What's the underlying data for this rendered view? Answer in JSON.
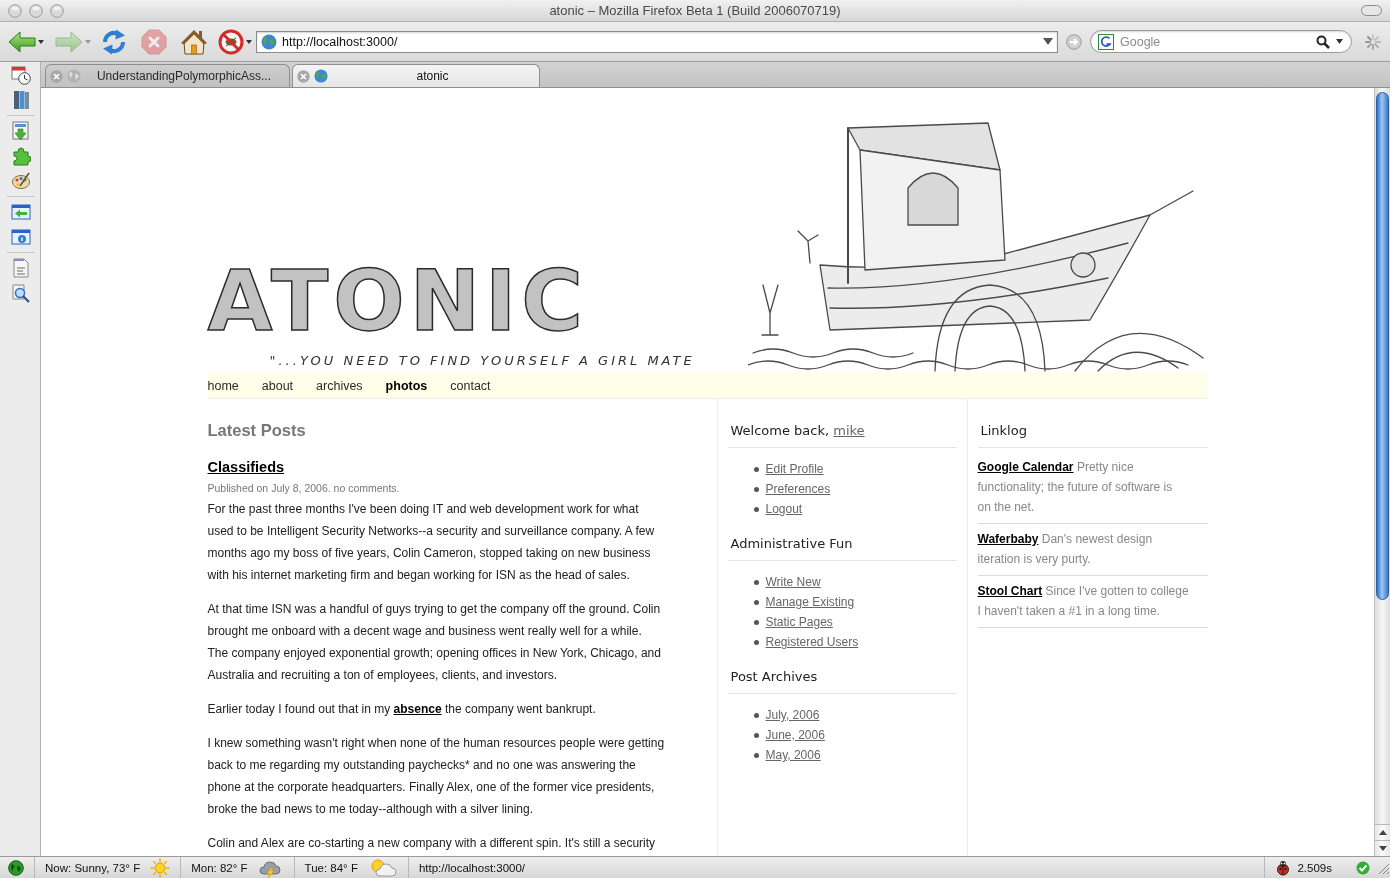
{
  "window": {
    "title": "atonic – Mozilla Firefox Beta 1 (Build 2006070719)"
  },
  "toolbar": {
    "back": {
      "disabled": false
    },
    "forward": {
      "disabled": true
    },
    "stop": {
      "disabled": true
    },
    "address": {
      "value": "http://localhost:3000/"
    },
    "search": {
      "placeholder": "Google"
    }
  },
  "tabs": [
    {
      "label": "UnderstandingPolymorphicAss...",
      "selected": false
    },
    {
      "label": "atonic",
      "selected": true
    }
  ],
  "header": {
    "logo": "ATONIC",
    "tagline": "\"...YOU NEED TO FIND YOURSELF A GIRL MATE"
  },
  "nav": [
    {
      "label": "home",
      "selected": false
    },
    {
      "label": "about",
      "selected": false
    },
    {
      "label": "archives",
      "selected": false
    },
    {
      "label": "photos",
      "selected": true
    },
    {
      "label": "contact",
      "selected": false
    }
  ],
  "main": {
    "heading": "Latest Posts",
    "post": {
      "title": "Classifieds",
      "meta": "Published on July 8, 2006. no comments.",
      "paragraphs": [
        {
          "segments": [
            {
              "kind": "text",
              "text": "For the past three months I've been doing IT and web development work for what\nused to be Intelligent Security Networks--a security and surveillance company. A few\nmonths ago my boss of five years, Colin Cameron, stopped taking on new business\nwith his internet marketing firm and began working for ISN as the head of sales."
            }
          ]
        },
        {
          "segments": [
            {
              "kind": "text",
              "text": "At that time ISN was a handful of guys trying to get the company off the ground. Colin\nbrought me onboard with a decent wage and business went really well for a while.\nThe company enjoyed exponential growth; opening offices in New York, Chicago, and\nAustralia and recruiting a ton of employees, clients, and investors."
            }
          ]
        },
        {
          "segments": [
            {
              "kind": "text",
              "text": "Earlier today I found out that in my "
            },
            {
              "kind": "link",
              "text": "absence"
            },
            {
              "kind": "text",
              "text": " the company went bankrupt."
            }
          ]
        },
        {
          "segments": [
            {
              "kind": "text",
              "text": "I knew something wasn't right when none of the human resources people were getting\nback to me regarding my outstanding paychecks* and no one was answering the\nphone at the corporate headquarters. Finally Alex, one of the former vice presidents,\nbroke the bad news to me today--although with a silver lining."
            }
          ]
        },
        {
          "segments": [
            {
              "kind": "text",
              "text": "Colin and Alex are co-starting a new company with a different spin. It's still a security"
            }
          ]
        }
      ]
    }
  },
  "sidebar": {
    "sections": [
      {
        "title": "Welcome back,",
        "title_link": "mike",
        "links": [
          "Edit Profile",
          "Preferences",
          "Logout"
        ]
      },
      {
        "title": "Administrative Fun",
        "links": [
          "Write New",
          "Manage Existing",
          "Static Pages",
          "Registered Users"
        ]
      },
      {
        "title": "Post Archives",
        "links": [
          "July, 2006",
          "June, 2006",
          "May, 2006"
        ]
      }
    ]
  },
  "linklog": {
    "title": "Linklog",
    "entries": [
      {
        "link": "Google Calendar",
        "text": "Pretty nice\nfunctionality; the future of software is\non the net."
      },
      {
        "link": "Waferbaby",
        "text": "Dan's newest design\niteration is very purty."
      },
      {
        "link": "Stool Chart",
        "text": "Since I've gotten to college\nI haven't taken a #1 in a long time."
      }
    ]
  },
  "status_bar": {
    "weather": [
      {
        "kind": "sunny",
        "label": "Now: Sunny, 73° F"
      },
      {
        "kind": "storm",
        "label": "Mon: 82° F"
      },
      {
        "kind": "partly-cloudy",
        "label": "Tue: 84° F"
      }
    ],
    "url": "http://localhost:3000/",
    "timer": "2.509s"
  }
}
